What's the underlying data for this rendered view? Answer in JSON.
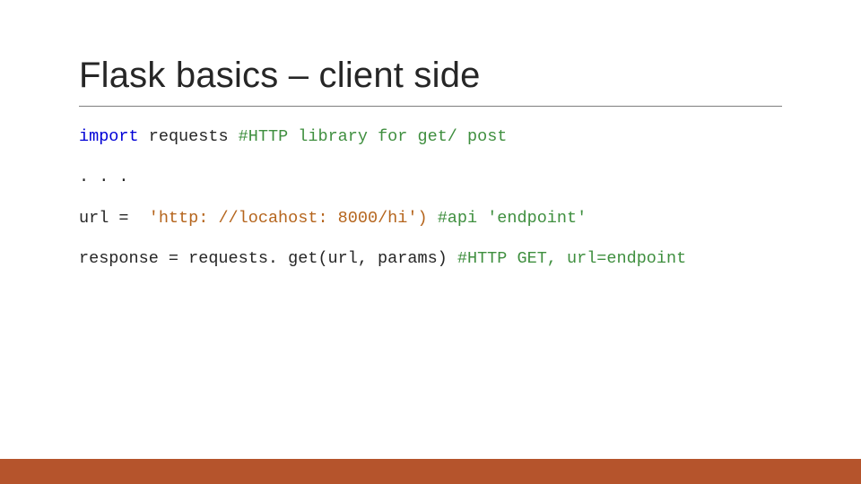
{
  "title": "Flask basics – client side",
  "code": {
    "l1": {
      "kw": "import",
      "sp": " ",
      "id": "requests ",
      "cm": "#HTTP library for get/ post"
    },
    "l2": ". . .",
    "l3": {
      "a": "url = ",
      "s1": " 'http: //locahost: 8000/",
      "s2": "hi') ",
      "cm": "#api 'endpoint'"
    },
    "l4": {
      "a": "response = requests. get(url, params) ",
      "cm": "#HTTP GET, url=endpoint"
    }
  }
}
